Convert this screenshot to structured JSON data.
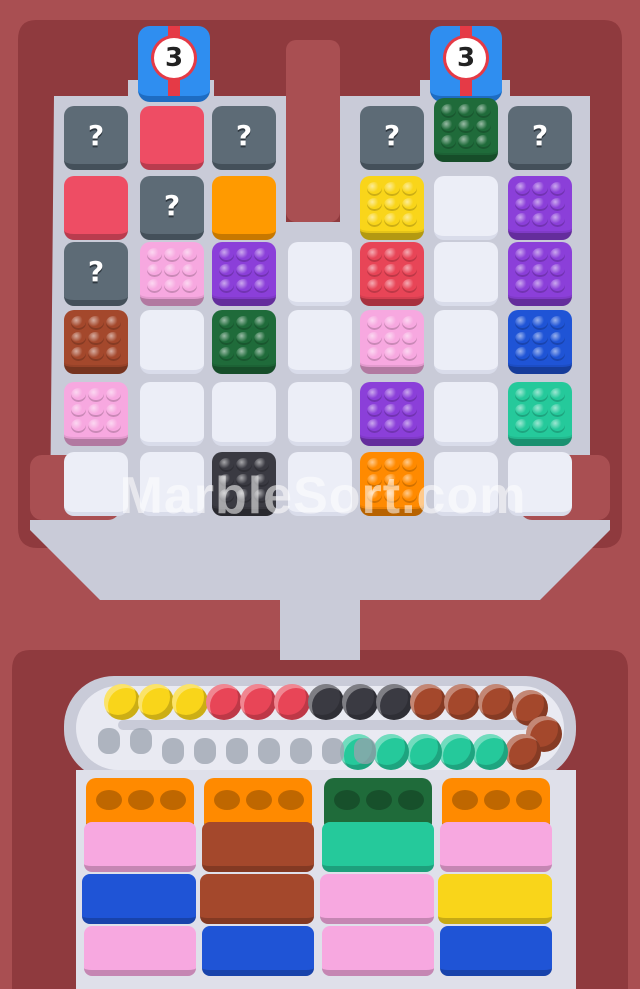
{
  "colors": {
    "background": "#a94f52",
    "board": "#c7c9d6",
    "pink": "#f7a8e0",
    "purple": "#8b3fd9",
    "green": "#1f6b3a",
    "brown": "#a4482c",
    "black": "#3a3a42",
    "yellow": "#f9d51a",
    "red": "#e84557",
    "blue": "#1f54d6",
    "teal": "#25c99b",
    "orange": "#ff8a00",
    "amber": "#ff9a00",
    "coral": "#ee4d64"
  },
  "gifts": [
    {
      "count": "3"
    },
    {
      "count": "3"
    }
  ],
  "mystery_label": "?",
  "left_board": [
    [
      "mystery",
      "coral-plain",
      "mystery"
    ],
    [
      "coral-plain",
      "mystery",
      "amber-plain"
    ],
    [
      "mystery",
      "pink",
      "purple",
      "empty"
    ],
    [
      "brown",
      "empty",
      "green",
      "empty"
    ],
    [
      "pink",
      "empty",
      "empty",
      "empty"
    ],
    [
      "empty",
      "empty",
      "black",
      "empty"
    ]
  ],
  "right_board": [
    [
      "mystery",
      "green",
      "mystery"
    ],
    [
      "yellow",
      "empty",
      "purple"
    ],
    [
      "red",
      "empty",
      "purple"
    ],
    [
      "pink",
      "empty",
      "blue"
    ],
    [
      "purple",
      "empty",
      "teal"
    ],
    [
      "orange",
      "empty"
    ]
  ],
  "conveyor": {
    "marbles": [
      "yellow",
      "yellow",
      "yellow",
      "red",
      "red",
      "red",
      "black",
      "black",
      "black",
      "brown",
      "brown",
      "brown",
      "brown",
      "brown",
      "brown",
      "teal",
      "teal",
      "teal",
      "teal",
      "teal",
      "teal"
    ],
    "empty_slots": 9
  },
  "bins": [
    {
      "cap": "orange",
      "bars": [
        "pink",
        "blue",
        "pink"
      ]
    },
    {
      "cap": "orange",
      "bars": [
        "brown",
        "brown",
        "blue"
      ]
    },
    {
      "cap": "green",
      "bars": [
        "teal",
        "pink",
        "pink"
      ]
    },
    {
      "cap": "orange",
      "bars": [
        "pink",
        "yellow",
        "blue"
      ]
    }
  ],
  "watermark": "MarbleSort.com"
}
